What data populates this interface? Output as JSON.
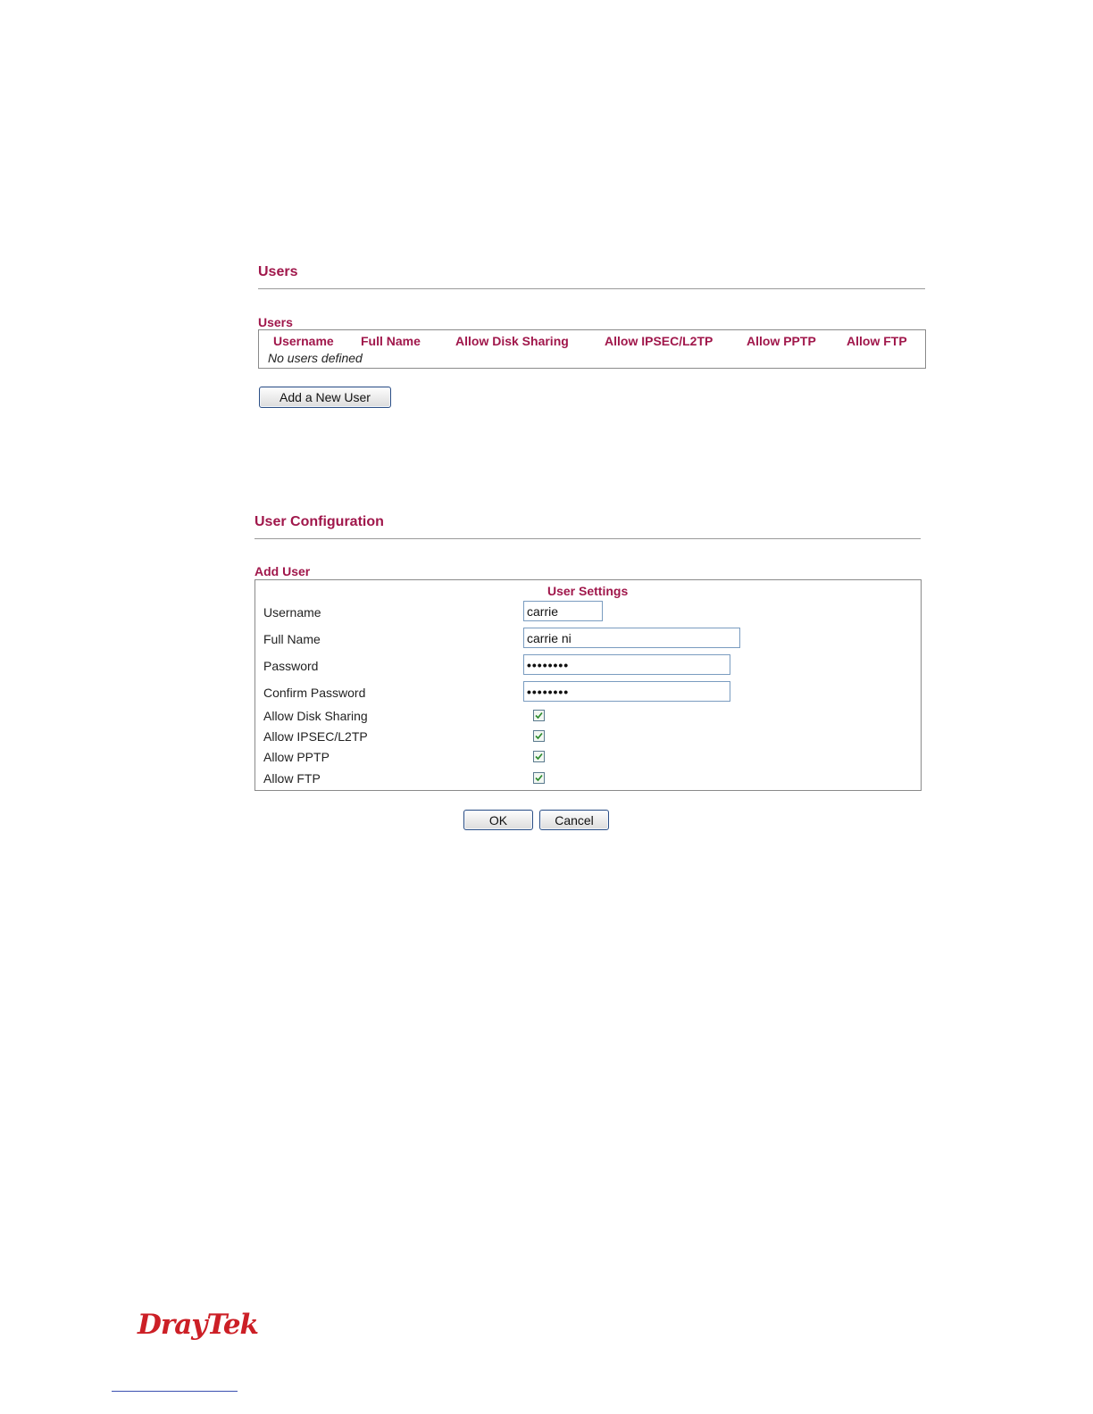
{
  "users_section": {
    "title": "Users",
    "table_caption": "Users",
    "columns": [
      "Username",
      "Full Name",
      "Allow Disk Sharing",
      "Allow IPSEC/L2TP",
      "Allow PPTP",
      "Allow FTP"
    ],
    "empty_message": "No users defined",
    "add_button_label": "Add a New User"
  },
  "config_section": {
    "title": "User Configuration",
    "box_caption": "Add User",
    "box_heading": "User Settings",
    "fields": {
      "username": {
        "label": "Username",
        "value": "carrie"
      },
      "full_name": {
        "label": "Full Name",
        "value": "carrie ni"
      },
      "password": {
        "label": "Password",
        "value": "••••••••"
      },
      "confirm_password": {
        "label": "Confirm Password",
        "value": "••••••••"
      }
    },
    "checkboxes": [
      {
        "label": "Allow Disk Sharing",
        "checked": true
      },
      {
        "label": "Allow IPSEC/L2TP",
        "checked": true
      },
      {
        "label": "Allow PPTP",
        "checked": true
      },
      {
        "label": "Allow FTP",
        "checked": true
      }
    ],
    "ok_label": "OK",
    "cancel_label": "Cancel"
  },
  "footer": {
    "logo_text": "DrayTek"
  },
  "colors": {
    "accent": "#a0174b",
    "logo": "#cc1f26",
    "button_border": "#2c4f86"
  }
}
